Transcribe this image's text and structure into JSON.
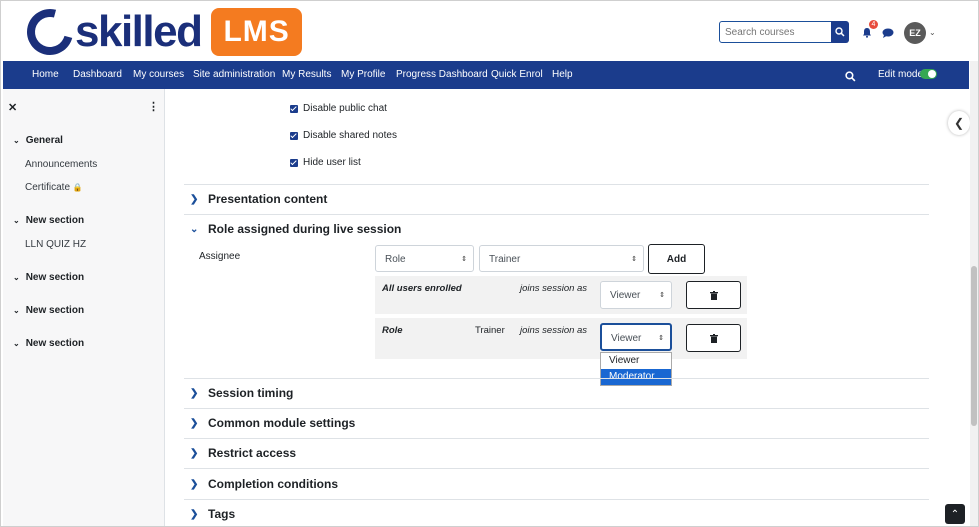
{
  "brand": {
    "word": "skilled",
    "lms": "LMS",
    "navy": "#1b3c8c",
    "orange": "#f47b20"
  },
  "header": {
    "search_placeholder": "Search courses",
    "notification_count": "4",
    "avatar_initials": "EZ"
  },
  "nav": {
    "items": [
      "Home",
      "Dashboard",
      "My courses",
      "Site administration",
      "My Results",
      "My Profile",
      "Progress Dashboard",
      "Quick Enrol",
      "Help"
    ],
    "edit_mode_label": "Edit mode",
    "edit_mode_on": true
  },
  "sidebar": {
    "sections": [
      {
        "title": "General",
        "items": [
          "Announcements",
          "Certificate"
        ]
      },
      {
        "title": "New section",
        "items": [
          "LLN QUIZ HZ"
        ]
      },
      {
        "title": "New section",
        "items": []
      },
      {
        "title": "New section",
        "items": []
      },
      {
        "title": "New section",
        "items": []
      }
    ]
  },
  "checkboxes": [
    {
      "label": "Disable public chat",
      "checked": true
    },
    {
      "label": "Disable shared notes",
      "checked": true
    },
    {
      "label": "Hide user list",
      "checked": true
    }
  ],
  "sections": {
    "presentation": "Presentation content",
    "role_assigned": "Role assigned during live session",
    "timing": "Session timing",
    "common": "Common module settings",
    "restrict": "Restrict access",
    "completion": "Completion conditions",
    "tags": "Tags"
  },
  "role_assign": {
    "assignee_label": "Assignee",
    "type_select": "Role",
    "value_select": "Trainer",
    "add_label": "Add",
    "rules": [
      {
        "who": "All users enrolled",
        "detail": "",
        "joins": "joins session as",
        "as": "Viewer"
      },
      {
        "who": "Role",
        "detail": "Trainer",
        "joins": "joins session as",
        "as": "Viewer"
      }
    ],
    "dropdown_options": [
      "Viewer",
      "Moderator"
    ],
    "dropdown_highlighted": "Moderator"
  }
}
